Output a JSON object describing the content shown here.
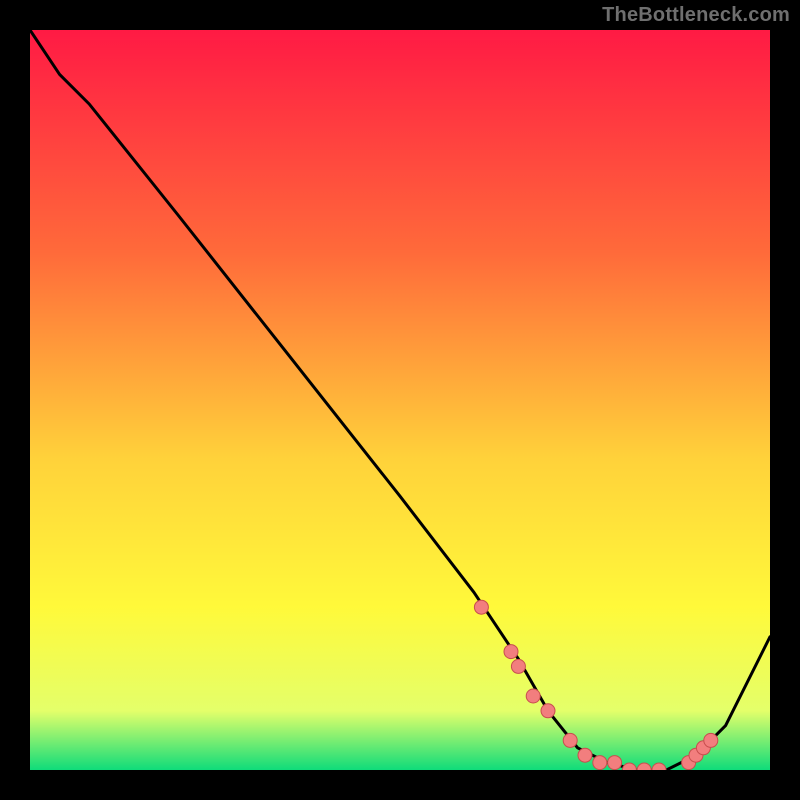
{
  "attribution": "TheBottleneck.com",
  "colors": {
    "gradient_top": "#ff1a44",
    "gradient_mid1": "#ff6a3a",
    "gradient_mid2": "#ffd23a",
    "gradient_mid3": "#fff93a",
    "gradient_mid4": "#e4ff6a",
    "gradient_bottom": "#0fdc7a",
    "curve": "#000000",
    "marker_fill": "#f27e7e",
    "marker_stroke": "#c84e4e"
  },
  "chart_data": {
    "type": "line",
    "title": "",
    "xlabel": "",
    "ylabel": "",
    "xlim": [
      0,
      100
    ],
    "ylim": [
      0,
      100
    ],
    "curve": {
      "x": [
        0,
        4,
        8,
        20,
        35,
        50,
        60,
        66,
        70,
        74,
        78,
        82,
        86,
        90,
        94,
        100
      ],
      "y": [
        100,
        94,
        90,
        75,
        56,
        37,
        24,
        15,
        8,
        3,
        1,
        0,
        0,
        2,
        6,
        18
      ]
    },
    "markers": {
      "x": [
        61,
        65,
        66,
        68,
        70,
        73,
        75,
        77,
        79,
        81,
        83,
        85,
        89,
        90,
        91,
        92
      ],
      "y": [
        22,
        16,
        14,
        10,
        8,
        4,
        2,
        1,
        1,
        0,
        0,
        0,
        1,
        2,
        3,
        4
      ]
    }
  }
}
